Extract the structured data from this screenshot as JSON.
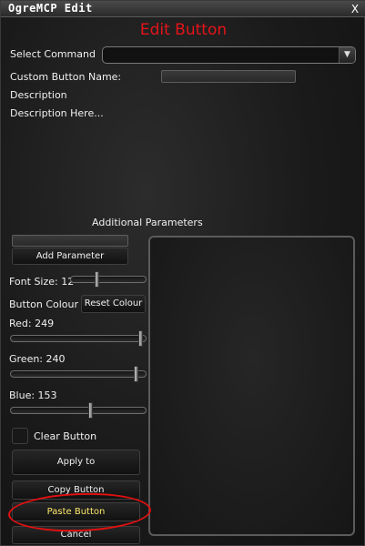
{
  "window": {
    "title": "OgreMCP Edit",
    "close_label": "X"
  },
  "heading": "Edit Button",
  "form": {
    "select_command_label": "Select Command",
    "select_command_value": "",
    "dropdown_arrow": "▼",
    "custom_name_label": "Custom Button Name:",
    "custom_name_value": "",
    "description_label": "Description",
    "description_text": "Description Here..."
  },
  "additional_parameters": {
    "label": "Additional Parameters",
    "param_value": "",
    "add_button": "Add Parameter"
  },
  "font": {
    "label": "Font Size: 12",
    "value": 12,
    "slider_fraction": 0.35
  },
  "colour": {
    "label": "Button Colour",
    "reset_button": "Reset Colour",
    "red_label": "Red: 249",
    "red_value": 249,
    "green_label": "Green: 240",
    "green_value": 240,
    "blue_label": "Blue: 153",
    "blue_value": 153,
    "max": 255
  },
  "clear_label": "Clear Button",
  "actions": {
    "apply": "Apply to",
    "copy": "Copy Button",
    "paste": "Paste Button",
    "cancel": "Cancel"
  },
  "colors": {
    "heading": "#e5141a",
    "paste_text": "#ffe96a",
    "annotation": "#e01010"
  }
}
